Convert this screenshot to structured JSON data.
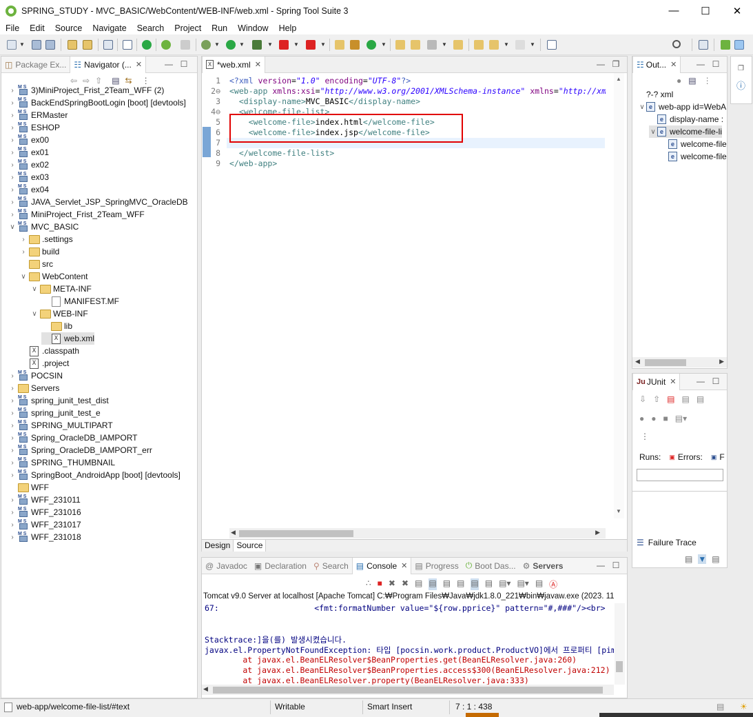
{
  "window": {
    "title": "SPRING_STUDY - MVC_BASIC/WebContent/WEB-INF/web.xml - Spring Tool Suite 3"
  },
  "menu": [
    "File",
    "Edit",
    "Source",
    "Navigate",
    "Search",
    "Project",
    "Run",
    "Window",
    "Help"
  ],
  "left": {
    "tabs": [
      {
        "label": "Package Ex..."
      },
      {
        "label": "Navigator (..."
      }
    ],
    "tree": [
      {
        "label": "3)MiniProject_Frist_2Team_WFF (2)",
        "level": 0,
        "type": "project",
        "expand": "closed"
      },
      {
        "label": "BackEndSpringBootLogin [boot] [devtools]",
        "level": 0,
        "type": "project",
        "expand": "closed"
      },
      {
        "label": "ERMaster",
        "level": 0,
        "type": "project",
        "expand": "closed"
      },
      {
        "label": "ESHOP",
        "level": 0,
        "type": "project",
        "expand": "closed"
      },
      {
        "label": "ex00",
        "level": 0,
        "type": "project",
        "expand": "closed"
      },
      {
        "label": "ex01",
        "level": 0,
        "type": "project",
        "expand": "closed"
      },
      {
        "label": "ex02",
        "level": 0,
        "type": "project",
        "expand": "closed"
      },
      {
        "label": "ex03",
        "level": 0,
        "type": "project",
        "expand": "closed"
      },
      {
        "label": "ex04",
        "level": 0,
        "type": "project",
        "expand": "closed"
      },
      {
        "label": "JAVA_Servlet_JSP_SpringMVC_OracleDB",
        "level": 0,
        "type": "project",
        "expand": "closed"
      },
      {
        "label": "MiniProject_Frist_2Team_WFF",
        "level": 0,
        "type": "project",
        "expand": "closed"
      },
      {
        "label": "MVC_BASIC",
        "level": 0,
        "type": "project",
        "expand": "open"
      },
      {
        "label": ".settings",
        "level": 1,
        "type": "folder",
        "expand": "closed"
      },
      {
        "label": "build",
        "level": 1,
        "type": "folder",
        "expand": "closed"
      },
      {
        "label": "src",
        "level": 1,
        "type": "folder",
        "expand": "none"
      },
      {
        "label": "WebContent",
        "level": 1,
        "type": "folder",
        "expand": "open"
      },
      {
        "label": "META-INF",
        "level": 2,
        "type": "folder",
        "expand": "open"
      },
      {
        "label": "MANIFEST.MF",
        "level": 3,
        "type": "doc",
        "expand": "none"
      },
      {
        "label": "WEB-INF",
        "level": 2,
        "type": "folder",
        "expand": "open"
      },
      {
        "label": "lib",
        "level": 3,
        "type": "folder",
        "expand": "none"
      },
      {
        "label": "web.xml",
        "level": 3,
        "type": "xml",
        "expand": "none",
        "selected": true
      },
      {
        "label": ".classpath",
        "level": 1,
        "type": "xml",
        "expand": "none"
      },
      {
        "label": ".project",
        "level": 1,
        "type": "xml",
        "expand": "none"
      },
      {
        "label": "POCSIN",
        "level": 0,
        "type": "project",
        "expand": "closed"
      },
      {
        "label": "Servers",
        "level": 0,
        "type": "folder",
        "expand": "closed"
      },
      {
        "label": "spring_junit_test_dist",
        "level": 0,
        "type": "project",
        "expand": "closed"
      },
      {
        "label": "spring_junit_test_e",
        "level": 0,
        "type": "project",
        "expand": "closed"
      },
      {
        "label": "SPRING_MULTIPART",
        "level": 0,
        "type": "project",
        "expand": "closed"
      },
      {
        "label": "Spring_OracleDB_IAMPORT",
        "level": 0,
        "type": "project",
        "expand": "closed"
      },
      {
        "label": "Spring_OracleDB_IAMPORT_err",
        "level": 0,
        "type": "project",
        "expand": "closed"
      },
      {
        "label": "SPRING_THUMBNAIL",
        "level": 0,
        "type": "project",
        "expand": "closed"
      },
      {
        "label": "SpringBoot_AndroidApp [boot] [devtools]",
        "level": 0,
        "type": "project",
        "expand": "closed"
      },
      {
        "label": "WFF",
        "level": 0,
        "type": "folder",
        "expand": "none"
      },
      {
        "label": "WFF_231011",
        "level": 0,
        "type": "project",
        "expand": "closed"
      },
      {
        "label": "WFF_231016",
        "level": 0,
        "type": "project",
        "expand": "closed"
      },
      {
        "label": "WFF_231017",
        "level": 0,
        "type": "project",
        "expand": "closed"
      },
      {
        "label": "WFF_231018",
        "level": 0,
        "type": "project",
        "expand": "closed"
      }
    ]
  },
  "editor": {
    "tab": "*web.xml",
    "lines": [
      {
        "n": "1",
        "text": "<?xml version=\"1.0\" encoding=\"UTF-8\"?>"
      },
      {
        "n": "2⊖",
        "text": "<web-app xmlns:xsi=\"http://www.w3.org/2001/XMLSchema-instance\" xmlns=\"http://xml"
      },
      {
        "n": "3",
        "text": "  <display-name>MVC_BASIC</display-name>"
      },
      {
        "n": "4⊖",
        "text": "  <welcome-file-list>"
      },
      {
        "n": "5",
        "text": "    <welcome-file>index.html</welcome-file>"
      },
      {
        "n": "6",
        "text": "    <welcome-file>index.jsp</welcome-file>"
      },
      {
        "n": "7",
        "text": ""
      },
      {
        "n": "8",
        "text": "  </welcome-file-list>"
      },
      {
        "n": "9",
        "text": "</web-app>"
      }
    ],
    "bottom_tabs": [
      "Design",
      "Source"
    ]
  },
  "outline": {
    "tab": "Out...",
    "items": [
      {
        "label": "?-? xml",
        "level": 0,
        "icon": "pi"
      },
      {
        "label": "web-app id=WebA",
        "level": 0,
        "icon": "e",
        "expand": "open"
      },
      {
        "label": "display-name :",
        "level": 1,
        "icon": "e"
      },
      {
        "label": "welcome-file-li",
        "level": 1,
        "icon": "e",
        "expand": "open",
        "selected": true
      },
      {
        "label": "welcome-file",
        "level": 2,
        "icon": "e"
      },
      {
        "label": "welcome-file",
        "level": 2,
        "icon": "e"
      }
    ]
  },
  "junit": {
    "tab": "JUnit",
    "runs": "Runs:",
    "errors": "Errors:",
    "failures": "F",
    "failure_trace": "Failure Trace"
  },
  "console": {
    "tabs": [
      "Javadoc",
      "Declaration",
      "Search",
      "Console",
      "Progress",
      "Boot Das...",
      "Servers"
    ],
    "header": "Tomcat v9.0 Server at localhost [Apache Tomcat] C:₩Program Files₩Java₩jdk1.8.0_221₩bin₩javaw.exe  (2023. 11",
    "lines": [
      {
        "text": "67:                    <fmt:formatNumber value=\"${row.pprice}\" pattern=\"#,###\"/><br>",
        "color": "#000080"
      },
      {
        "text": "",
        "color": "#000"
      },
      {
        "text": "",
        "color": "#000"
      },
      {
        "text": "Stacktrace:]을(를) 발생시켰습니다.",
        "color": "#000080"
      },
      {
        "text": "javax.el.PropertyNotFoundException: 타입 [pocsin.work.product.ProductVO]에서 프로퍼티 [pima",
        "color": "#000080"
      },
      {
        "text": "        at javax.el.BeanELResolver$BeanProperties.get(BeanELResolver.java:260)",
        "color": "#c00000"
      },
      {
        "text": "        at javax.el.BeanELResolver$BeanProperties.access$300(BeanELResolver.java:212)",
        "color": "#c00000"
      },
      {
        "text": "        at javax.el.BeanELResolver.property(BeanELResolver.java:333)",
        "color": "#c00000"
      }
    ]
  },
  "status": {
    "path": "web-app/welcome-file-list/#text",
    "writable": "Writable",
    "insert": "Smart Insert",
    "position": "7 : 1 : 438"
  },
  "colors": {
    "highlight_box": "#e10000",
    "selection": "#e2e2e2"
  }
}
